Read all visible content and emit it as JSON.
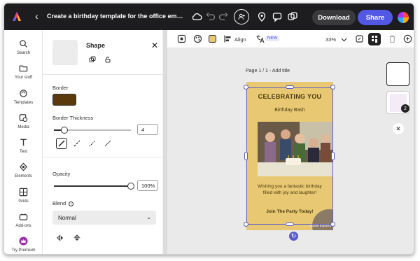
{
  "topbar": {
    "doc_title": "Create a birthday template for the office employees - January",
    "download_label": "Download",
    "share_label": "Share",
    "colors": {
      "bar": "#1d1d1f",
      "share": "#5258e4"
    }
  },
  "leftnav": {
    "items": [
      {
        "label": "Search",
        "icon": "search-icon"
      },
      {
        "label": "Your stuff",
        "icon": "folder-icon"
      },
      {
        "label": "Templates",
        "icon": "templates-icon"
      },
      {
        "label": "Media",
        "icon": "media-icon"
      },
      {
        "label": "Text",
        "icon": "text-icon"
      },
      {
        "label": "Elements",
        "icon": "elements-icon"
      },
      {
        "label": "Grids",
        "icon": "grids-icon"
      },
      {
        "label": "Add-ons",
        "icon": "addons-icon"
      },
      {
        "label": "Try Premium",
        "icon": "premium-crown-icon"
      }
    ]
  },
  "panel": {
    "title": "Shape",
    "border_label": "Border",
    "border_color": "#5a3a0a",
    "thickness_label": "Border Thickness",
    "thickness_value": "4",
    "thickness_level": 0.14,
    "opacity_label": "Opacity",
    "opacity_value": "100%",
    "opacity_level": 1.0,
    "blend_label": "Blend",
    "blend_value": "Normal"
  },
  "canvas_toolbar": {
    "align_label": "Align",
    "new_badge": "NEW",
    "zoom": "33%"
  },
  "canvas": {
    "page_label": "Page 1 / 1 - Add title"
  },
  "poster": {
    "headline": "CELEBRATING YOU",
    "subhead": "Birthday Bash",
    "body": "Wishing you a fantastic birthday filled with joy and laughter!",
    "cta": "Join The Party Today!",
    "brand": "Adobe Express",
    "colors": {
      "background": "#e8c873",
      "text": "#4a3a10"
    }
  },
  "pages_rail": {
    "page_count": "2"
  }
}
